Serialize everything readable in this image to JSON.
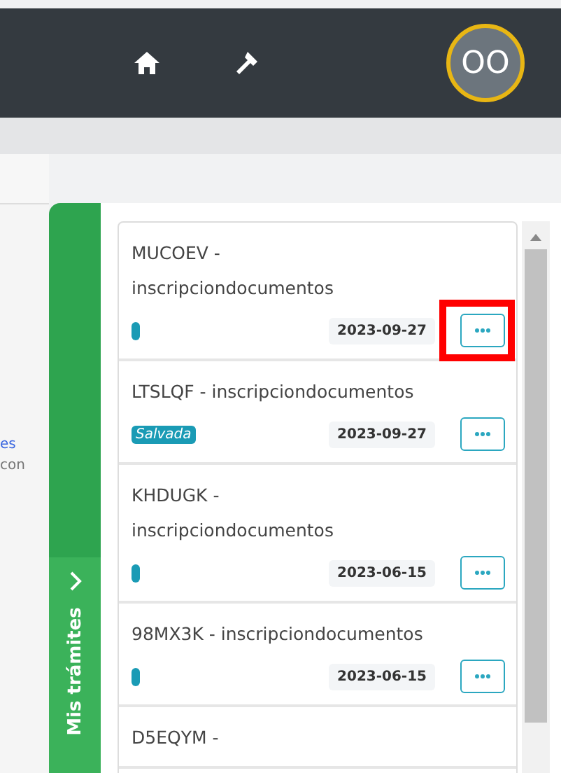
{
  "top_bar": {
    "avatar": {
      "initials": "OO"
    }
  },
  "background": {
    "link_fragment": "es",
    "text_fragment": "con"
  },
  "drawer_tab": {
    "label": "Mis trámites",
    "expanded": true
  },
  "tramites": [
    {
      "title": "MUCOEV -\ninscripciondocumentos",
      "status": {
        "kind": "dot"
      },
      "date": "2023-09-27",
      "highlighted": true
    },
    {
      "title": "LTSLQF - inscripciondocumentos",
      "status": {
        "kind": "badge",
        "label": "Salvada"
      },
      "date": "2023-09-27",
      "highlighted": false
    },
    {
      "title": "KHDUGK -\ninscripciondocumentos",
      "status": {
        "kind": "dot"
      },
      "date": "2023-06-15",
      "highlighted": false
    },
    {
      "title": "98MX3K - inscripciondocumentos",
      "status": {
        "kind": "dot"
      },
      "date": "2023-06-15",
      "highlighted": false
    },
    {
      "title": "D5EQYM -"
    }
  ]
}
